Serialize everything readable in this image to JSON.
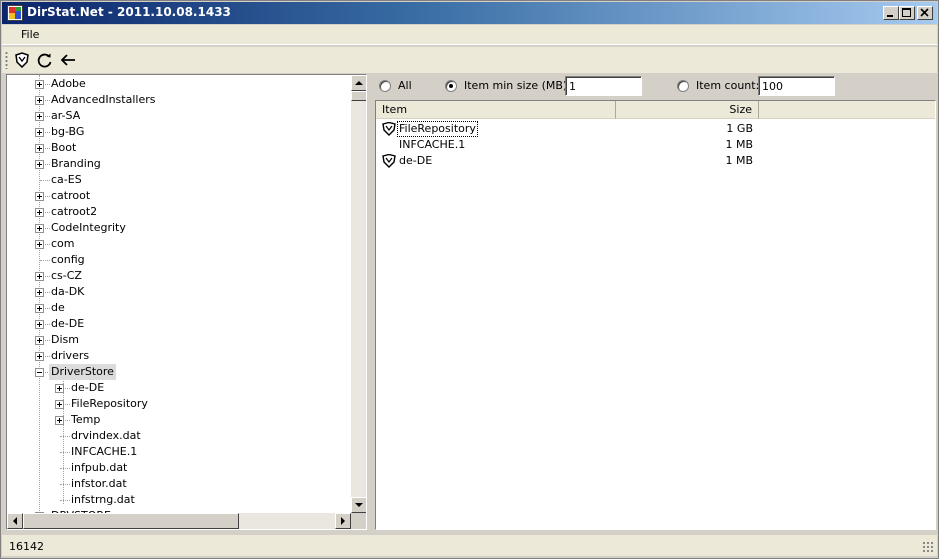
{
  "window": {
    "title": "DirStat.Net - 2011.10.08.1433",
    "controls": [
      "minimize-icon",
      "maximize-icon",
      "close-icon"
    ]
  },
  "menu": {
    "file": "File"
  },
  "toolbar": {
    "buttons": [
      {
        "name": "scan-button",
        "icon": "shield-icon"
      },
      {
        "name": "refresh-button",
        "icon": "refresh-icon"
      },
      {
        "name": "back-button",
        "icon": "back-arrow-icon"
      }
    ]
  },
  "tree": {
    "items": [
      {
        "label": "Adobe",
        "expandable": true,
        "level": 0
      },
      {
        "label": "AdvancedInstallers",
        "expandable": true,
        "level": 0
      },
      {
        "label": "ar-SA",
        "expandable": true,
        "level": 0
      },
      {
        "label": "bg-BG",
        "expandable": true,
        "level": 0
      },
      {
        "label": "Boot",
        "expandable": true,
        "level": 0
      },
      {
        "label": "Branding",
        "expandable": true,
        "level": 0
      },
      {
        "label": "ca-ES",
        "expandable": false,
        "level": 0
      },
      {
        "label": "catroot",
        "expandable": true,
        "level": 0
      },
      {
        "label": "catroot2",
        "expandable": true,
        "level": 0
      },
      {
        "label": "CodeIntegrity",
        "expandable": true,
        "level": 0
      },
      {
        "label": "com",
        "expandable": true,
        "level": 0
      },
      {
        "label": "config",
        "expandable": false,
        "level": 0
      },
      {
        "label": "cs-CZ",
        "expandable": true,
        "level": 0
      },
      {
        "label": "da-DK",
        "expandable": true,
        "level": 0
      },
      {
        "label": "de",
        "expandable": true,
        "level": 0
      },
      {
        "label": "de-DE",
        "expandable": true,
        "level": 0
      },
      {
        "label": "Dism",
        "expandable": true,
        "level": 0
      },
      {
        "label": "drivers",
        "expandable": true,
        "level": 0
      },
      {
        "label": "DriverStore",
        "expandable": true,
        "expanded": true,
        "selected": true,
        "level": 0
      },
      {
        "label": "de-DE",
        "expandable": true,
        "level": 1
      },
      {
        "label": "FileRepository",
        "expandable": true,
        "level": 1
      },
      {
        "label": "Temp",
        "expandable": true,
        "level": 1
      },
      {
        "label": "drvindex.dat",
        "expandable": false,
        "level": 1
      },
      {
        "label": "INFCACHE.1",
        "expandable": false,
        "level": 1
      },
      {
        "label": "infpub.dat",
        "expandable": false,
        "level": 1
      },
      {
        "label": "infstor.dat",
        "expandable": false,
        "level": 1
      },
      {
        "label": "infstrng.dat",
        "expandable": false,
        "level": 1
      },
      {
        "label": "DRVSTORE",
        "expandable": true,
        "level": 0
      }
    ],
    "vertical_scroll_position": 0.99,
    "horizontal_scroll_position": 0.0
  },
  "filter": {
    "all_label": "All",
    "min_size_label": "Item min size (MB):",
    "min_size_value": "1",
    "count_label": "Item count:",
    "count_value": "100",
    "selected": "min_size"
  },
  "list": {
    "columns": {
      "item": "Item",
      "size": "Size"
    },
    "rows": [
      {
        "name": "FileRepository",
        "size": "1 GB",
        "icon": "shield-icon",
        "focused": true
      },
      {
        "name": "INFCACHE.1",
        "size": "1 MB",
        "icon": "",
        "focused": false
      },
      {
        "name": "de-DE",
        "size": "1 MB",
        "icon": "shield-icon",
        "focused": false
      }
    ]
  },
  "status": {
    "text": "16142"
  }
}
